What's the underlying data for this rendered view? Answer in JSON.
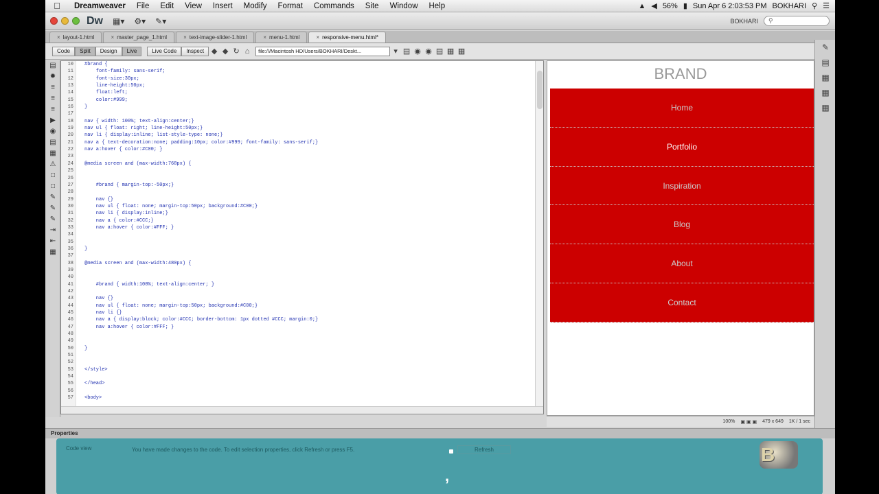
{
  "menubar": {
    "app_name": "Dreamweaver",
    "items": [
      "File",
      "Edit",
      "View",
      "Insert",
      "Modify",
      "Format",
      "Commands",
      "Site",
      "Window",
      "Help"
    ],
    "status": {
      "battery": "56%",
      "datetime": "Sun Apr 6  2:03:53 PM",
      "user": "BOKHARI"
    }
  },
  "appbar": {
    "logo": "Dw",
    "user": "BOKHARI"
  },
  "tabs": [
    {
      "label": "layout-1.html"
    },
    {
      "label": "master_page_1.html"
    },
    {
      "label": "text-image-slider-1.html"
    },
    {
      "label": "menu-1.html"
    },
    {
      "label": "responsive-menu.html*"
    }
  ],
  "doc_toolbar": {
    "code": "Code",
    "split": "Split",
    "design": "Design",
    "live": "Live",
    "live_code": "Live Code",
    "inspect": "Inspect",
    "address": "file:///Macintosh HD/Users/BOKHARI/Deskt..."
  },
  "code": {
    "line_numbers": [
      "10",
      "11",
      "12",
      "13",
      "14",
      "15",
      "16",
      "17",
      "18",
      "19",
      "20",
      "21",
      "22",
      "23",
      "24",
      "25",
      "26",
      "27",
      "28",
      "29",
      "30",
      "31",
      "32",
      "33",
      "34",
      "35",
      "36",
      "37",
      "38",
      "39",
      "40",
      "41",
      "42",
      "43",
      "44",
      "45",
      "46",
      "47",
      "48",
      "49",
      "50",
      "51",
      "52",
      "53",
      "54",
      "55",
      "56",
      "57"
    ],
    "lines": [
      "#brand {",
      "    font-family: sans-serif;",
      "    font-size:30px;",
      "    line-height:50px;",
      "    float:left;",
      "    color:#999;",
      "}",
      "",
      "nav { width: 100%; text-align:center;}",
      "nav ul { float: right; line-height:50px;}",
      "nav li { display:inline; list-style-type: none;}",
      "nav a { text-decoration:none; padding:10px; color:#999; font-family: sans-serif;}",
      "nav a:hover { color:#C00; }",
      "",
      "@media screen and (max-width:768px) {",
      "",
      "",
      "    #brand { margin-top:-50px;}",
      "",
      "    nav {}",
      "    nav ul { float: none; margin-top:50px; background:#C00;}",
      "    nav li { display:inline;}",
      "    nav a { color:#CCC;}",
      "    nav a:hover { color:#FFF; }",
      "",
      "",
      "}",
      "",
      "@media screen and (max-width:480px) {",
      "",
      "",
      "    #brand { width:100%; text-align:center; }",
      "",
      "    nav {}",
      "    nav ul { float: none; margin-top:50px; background:#C00;}",
      "    nav li {}",
      "    nav a { display:block; color:#CCC; border-bottom: 1px dotted #CCC; margin:0;}",
      "    nav a:hover { color:#FFF; }",
      "",
      "",
      "}",
      "",
      "",
      "</style>",
      "",
      "</head>",
      "",
      "<body>"
    ]
  },
  "live_view": {
    "brand": "BRAND",
    "nav": [
      "Home",
      "Portfolio",
      "Inspiration",
      "Blog",
      "About",
      "Contact"
    ],
    "hover_index": 1
  },
  "status_bar": {
    "zoom": "100%",
    "size": "479 x 649",
    "weight": "1K / 1 sec"
  },
  "properties": {
    "title": "Properties",
    "mode": "Code view",
    "message": "You have made changes to the code. To edit selection properties, click Refresh or press F5.",
    "refresh": "Refresh"
  },
  "colors": {
    "nav_bg": "#CC0000",
    "nav_text": "#CCCCCC",
    "brand": "#999999",
    "overlay": "#3796A0"
  }
}
